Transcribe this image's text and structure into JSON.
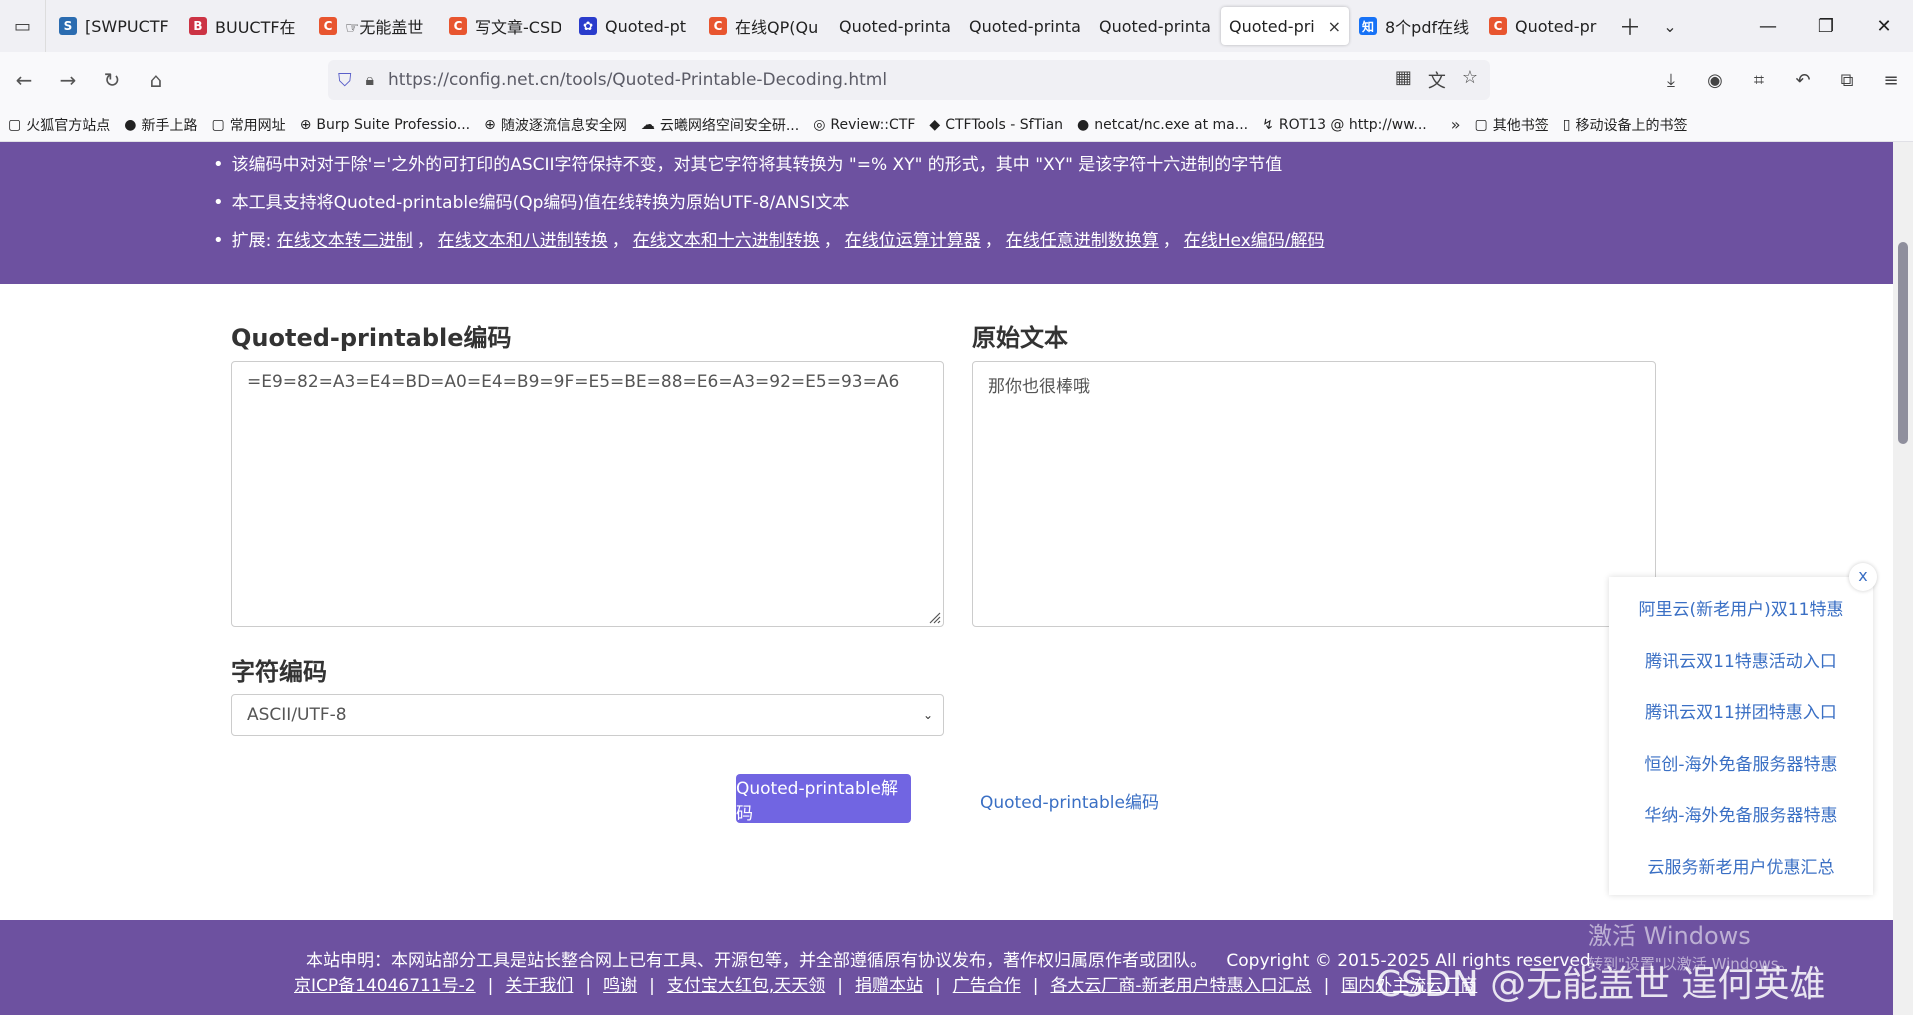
{
  "tabs": [
    {
      "title": "[SWPUCTF",
      "icon_color": "#2b6cb0",
      "icon_text": "S"
    },
    {
      "title": "BUUCTF在",
      "icon_color": "#cc3344",
      "icon_text": "B"
    },
    {
      "title": "☞无能盖世",
      "icon_color": "#e8552f",
      "icon_text": "C"
    },
    {
      "title": "写文章-CSD",
      "icon_color": "#e8552f",
      "icon_text": "C"
    },
    {
      "title": "Quoted-pt",
      "icon_color": "#2a3ccc",
      "icon_text": "✿"
    },
    {
      "title": "在线QP(Qu",
      "icon_color": "#e8552f",
      "icon_text": "C"
    },
    {
      "title": "Quoted-printa",
      "icon_color": "",
      "icon_text": ""
    },
    {
      "title": "Quoted-printa",
      "icon_color": "",
      "icon_text": ""
    },
    {
      "title": "Quoted-printa",
      "icon_color": "",
      "icon_text": ""
    },
    {
      "title": "Quoted-pri",
      "icon_color": "",
      "icon_text": "",
      "active": true,
      "close": "×"
    },
    {
      "title": "8个pdf在线",
      "icon_color": "#1772f6",
      "icon_text": "知"
    },
    {
      "title": "Quoted-pr",
      "icon_color": "#e8552f",
      "icon_text": "C"
    }
  ],
  "toolbar": {
    "url": "https://config.net.cn/tools/Quoted-Printable-Decoding.html"
  },
  "bookmarks": [
    {
      "label": "火狐官方站点",
      "icon": "▢"
    },
    {
      "label": "新手上路",
      "icon": "●"
    },
    {
      "label": "常用网址",
      "icon": "▢"
    },
    {
      "label": "Burp Suite Professio...",
      "icon": "⊕"
    },
    {
      "label": "随波逐流信息安全网",
      "icon": "⊕"
    },
    {
      "label": "云曦网络空间安全研...",
      "icon": "☁"
    },
    {
      "label": "Review::CTF",
      "icon": "◎"
    },
    {
      "label": "CTFTools - SfTian",
      "icon": "◆"
    },
    {
      "label": "netcat/nc.exe at ma...",
      "icon": "●"
    },
    {
      "label": "ROT13 @ http://ww...",
      "icon": "↯"
    }
  ],
  "bookmarks_right": [
    {
      "label": "其他书签",
      "icon": "▢"
    },
    {
      "label": "移动设备上的书签",
      "icon": "▯"
    }
  ],
  "hero": {
    "line1": "该编码中对对于除'='之外的可打印的ASCII字符保持不变，对其它字符将其转换为 \"=% XY\" 的形式，其中 \"XY\" 是该字符十六进制的字节值",
    "line2": "本工具支持将Quoted-printable编码(Qp编码)值在线转换为原始UTF-8/ANSI文本",
    "line3_prefix": "扩展: ",
    "links": [
      "在线文本转二进制",
      "在线文本和八进制转换",
      "在线文本和十六进制转换",
      "在线位运算计算器",
      "在线任意进制数换算",
      "在线Hex编码/解码"
    ],
    "separator": "，"
  },
  "form": {
    "qp_label": "Quoted-printable编码",
    "qp_value": "=E9=82=A3=E4=BD=A0=E4=B9=9F=E5=BE=88=E6=A3=92=E5=93=A6",
    "orig_label": "原始文本",
    "orig_value": "那你也很棒哦",
    "charset_label": "字符编码",
    "charset_value": "ASCII/UTF-8",
    "decode_button": "Quoted-printable解码",
    "encode_link": "Quoted-printable编码"
  },
  "ads": {
    "close": "x",
    "items": [
      "阿里云(新老用户)双11特惠",
      "腾讯云双11特惠活动入口",
      "腾讯云双11拼团特惠入口",
      "恒创-海外免备服务器特惠",
      "华纳-海外免备服务器特惠",
      "云服务新老用户优惠汇总"
    ]
  },
  "footer": {
    "statement": "本站申明：本网站部分工具是站长整合网上已有工具、开源包等，并全部遵循原有协议发布，著作权归属原作者或团队。",
    "copyright": "Copyright © 2015-2025 All rights reserved.",
    "links": [
      "京ICP备14046711号-2",
      "关于我们",
      "鸣谢",
      "支付宝大红包,天天领",
      "捐赠本站",
      "广告合作",
      "各大云厂商-新老用户特惠入口汇总",
      "国内外主流云厂商"
    ],
    "separator": "|"
  },
  "watermarks": {
    "windows_line1": "激活 Windows",
    "windows_line2": "转到\"设置\"以激活 Windows。",
    "csdn": "CSDN @无能盖世 逞何英雄"
  }
}
